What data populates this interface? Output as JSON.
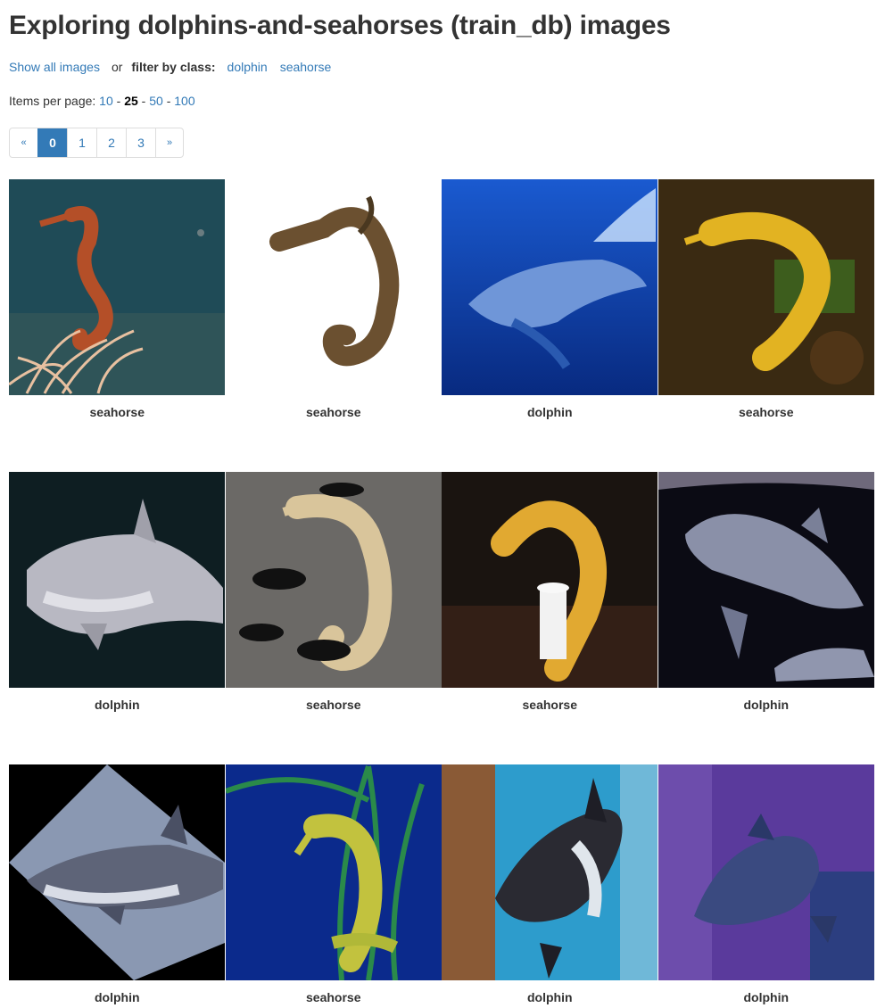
{
  "page": {
    "title": "Exploring dolphins-and-seahorses (train_db) images",
    "show_all": "Show all images",
    "or_text": "or",
    "filter_label": "filter by class:",
    "classes": [
      "dolphin",
      "seahorse"
    ],
    "per_page_label": "Items per page:",
    "per_page_options": [
      "10",
      "25",
      "50",
      "100"
    ],
    "per_page_selected": "25",
    "separator": "-"
  },
  "pagination": {
    "prev": "«",
    "next": "»",
    "pages": [
      "0",
      "1",
      "2",
      "3"
    ],
    "current": "0"
  },
  "images": [
    {
      "label": "seahorse",
      "colors": [
        "#1e4a55",
        "#b5502a"
      ]
    },
    {
      "label": "seahorse",
      "colors": [
        "#ffffff",
        "#6b5030"
      ]
    },
    {
      "label": "dolphin",
      "colors": [
        "#0e3fa0",
        "#8fb3e8"
      ]
    },
    {
      "label": "seahorse",
      "colors": [
        "#3b2a10",
        "#e0b020"
      ]
    },
    {
      "label": "dolphin",
      "colors": [
        "#0d1e22",
        "#b8b8c0"
      ]
    },
    {
      "label": "seahorse",
      "colors": [
        "#6a6866",
        "#d8c49a"
      ]
    },
    {
      "label": "seahorse",
      "colors": [
        "#1a1410",
        "#e0a830"
      ]
    },
    {
      "label": "dolphin",
      "colors": [
        "#0a0a12",
        "#8a90a8"
      ]
    },
    {
      "label": "dolphin",
      "colors": [
        "#000000",
        "#6e7486"
      ]
    },
    {
      "label": "seahorse",
      "colors": [
        "#0b2a8c",
        "#c0c040"
      ]
    },
    {
      "label": "dolphin",
      "colors": [
        "#2c9ccc",
        "#2a2a32"
      ]
    },
    {
      "label": "dolphin",
      "colors": [
        "#5a3a9c",
        "#3a4a80"
      ]
    }
  ]
}
